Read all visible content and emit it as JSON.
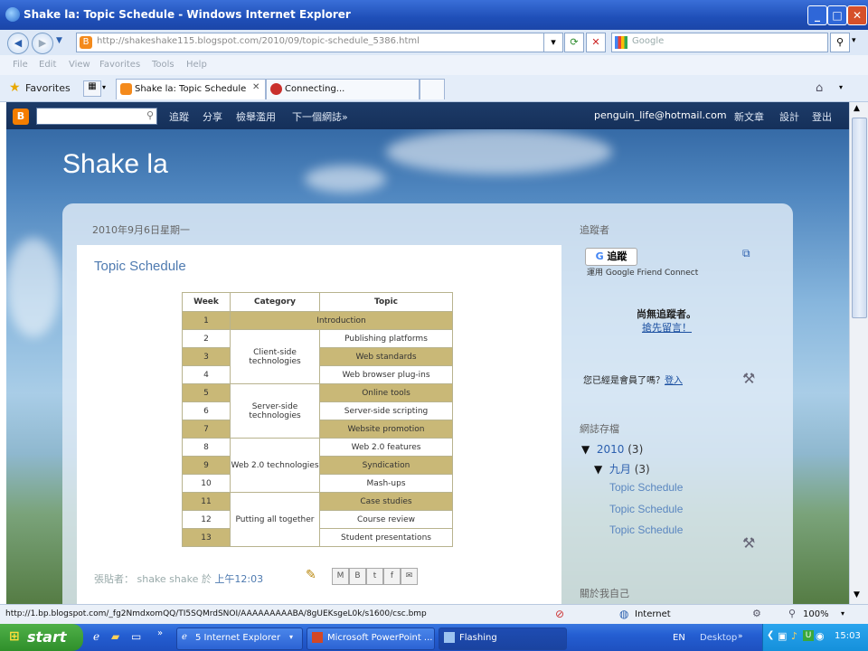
{
  "window": {
    "title": "Shake la: Topic Schedule - Windows Internet Explorer"
  },
  "address": {
    "url": "http://shakeshake115.blogspot.com/2010/09/topic-schedule_5386.html",
    "search_placeholder": "Google"
  },
  "menu": [
    "File",
    "Edit",
    "View",
    "Favorites",
    "Tools",
    "Help"
  ],
  "favorites": {
    "label": "Favorites"
  },
  "tabs": [
    {
      "label": "Shake la: Topic Schedule"
    },
    {
      "label": "Connecting..."
    }
  ],
  "navbar": {
    "links": [
      "追蹤",
      "分享",
      "檢舉濫用",
      "下一個網誌»"
    ],
    "user": "penguin_life@hotmail.com",
    "right": [
      "新文章",
      "設計",
      "登出"
    ]
  },
  "blog": {
    "title": "Shake la"
  },
  "post": {
    "date": "2010年9月6日星期一",
    "title": "Topic Schedule",
    "footer_prefix": "張貼者：",
    "author": "shake shake",
    "at": "於",
    "time": "上午12:03"
  },
  "table": {
    "headers": [
      "Week",
      "Category",
      "Topic"
    ],
    "rows": [
      {
        "week": "1",
        "topic": "Introduction"
      },
      {
        "week": "2",
        "topic": "Publishing platforms"
      },
      {
        "week": "3",
        "topic": "Web standards"
      },
      {
        "week": "4",
        "topic": "Web browser plug-ins"
      },
      {
        "week": "5",
        "topic": "Online tools"
      },
      {
        "week": "6",
        "topic": "Server-side scripting"
      },
      {
        "week": "7",
        "topic": "Website promotion"
      },
      {
        "week": "8",
        "topic": "Web 2.0 features"
      },
      {
        "week": "9",
        "topic": "Syndication"
      },
      {
        "week": "10",
        "topic": "Mash-ups"
      },
      {
        "week": "11",
        "topic": "Case studies"
      },
      {
        "week": "12",
        "topic": "Course review"
      },
      {
        "week": "13",
        "topic": "Student presentations"
      }
    ],
    "categories": [
      "Client-side technologies",
      "Server-side technologies",
      "Web 2.0 technologies",
      "Putting all together"
    ]
  },
  "sidebar": {
    "followers_heading": "追蹤者",
    "follow_button": "追蹤",
    "gfc_prefix": "運用",
    "gfc": "Google Friend Connect",
    "no_followers": "尚無追蹤者。",
    "be_first": "搶先留言！",
    "member_q": "您已經是會員了嗎？",
    "login": "登入",
    "archive_heading": "網誌存檔",
    "year": "2010",
    "year_count": "(3)",
    "month": "九月",
    "month_count": "(3)",
    "posts": [
      "Topic Schedule",
      "Topic Schedule",
      "Topic Schedule"
    ],
    "about_heading": "關於我自己"
  },
  "status": {
    "url": "http://1.bp.blogspot.com/_fg2NmdxomQQ/TI5SQMrdSNOI/AAAAAAAAABA/8gUEKsgeL0k/s1600/csc.bmp",
    "zone": "Internet",
    "zoom": "100%"
  },
  "taskbar": {
    "start": "start",
    "items": [
      "5 Internet Explorer",
      "Microsoft PowerPoint ...",
      "Flashing"
    ],
    "lang": "EN",
    "desktop": "Desktop",
    "clock": "15:03"
  }
}
